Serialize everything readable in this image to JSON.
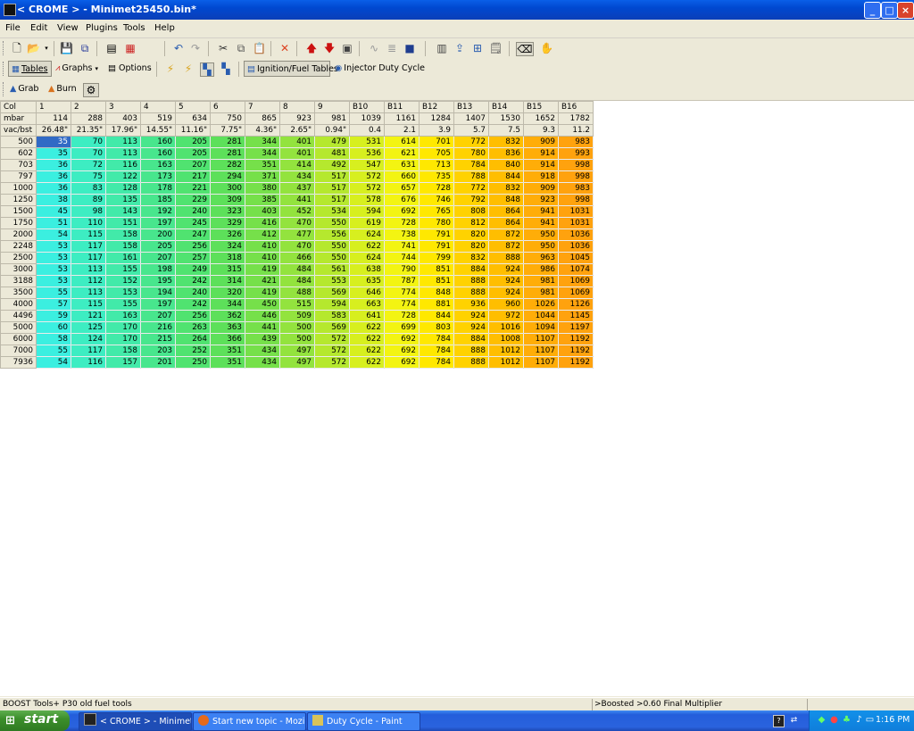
{
  "window": {
    "title": "< CROME > - Minimet25450.bin*",
    "controls": [
      "minimize",
      "maximize",
      "close"
    ]
  },
  "menu": [
    "File",
    "Edit",
    "View",
    "Plugins",
    "Tools",
    "Help"
  ],
  "toolbar3": {
    "grab_label": "Grab",
    "burn_label": "Burn"
  },
  "toolbar2": {
    "tables_label": "Tables",
    "graphs_label": "Graphs",
    "options_label": "Options",
    "ignition_label": "Ignition/Fuel Tables",
    "injector_label": "Injector Duty Cycle"
  },
  "table": {
    "col_header_label": "Col",
    "mbar_label": "mbar",
    "vacbst_label": "vac/bst",
    "columns": [
      "1",
      "2",
      "3",
      "4",
      "5",
      "6",
      "7",
      "8",
      "9",
      "B10",
      "B11",
      "B12",
      "B13",
      "B14",
      "B15",
      "B16"
    ],
    "mbar": [
      "114",
      "288",
      "403",
      "519",
      "634",
      "750",
      "865",
      "923",
      "981",
      "1039",
      "1161",
      "1284",
      "1407",
      "1530",
      "1652",
      "1782"
    ],
    "vacbst": [
      "26.48\"",
      "21.35\"",
      "17.96\"",
      "14.55\"",
      "11.16\"",
      "7.75\"",
      "4.36\"",
      "2.65\"",
      "0.94\"",
      "0.4",
      "2.1",
      "3.9",
      "5.7",
      "7.5",
      "9.3",
      "11.2"
    ],
    "col_colors": [
      "#3BEFE0",
      "#3DEDC2",
      "#42EAA9",
      "#48E68D",
      "#50E370",
      "#5DE05A",
      "#76E04A",
      "#93E33E",
      "#B5E82E",
      "#D7EF1F",
      "#F3F412",
      "#FFE800",
      "#FFD200",
      "#FFBE00",
      "#FFAD08",
      "#FFA20E"
    ],
    "selected_cell": {
      "row": 0,
      "col": 0
    },
    "rows": [
      {
        "rpm": "500",
        "v": [
          "35",
          "70",
          "113",
          "160",
          "205",
          "281",
          "344",
          "401",
          "479",
          "531",
          "614",
          "701",
          "772",
          "832",
          "909",
          "983"
        ]
      },
      {
        "rpm": "602",
        "v": [
          "35",
          "70",
          "113",
          "160",
          "205",
          "281",
          "344",
          "401",
          "481",
          "536",
          "621",
          "705",
          "780",
          "836",
          "914",
          "993"
        ]
      },
      {
        "rpm": "703",
        "v": [
          "36",
          "72",
          "116",
          "163",
          "207",
          "282",
          "351",
          "414",
          "492",
          "547",
          "631",
          "713",
          "784",
          "840",
          "914",
          "998"
        ]
      },
      {
        "rpm": "797",
        "v": [
          "36",
          "75",
          "122",
          "173",
          "217",
          "294",
          "371",
          "434",
          "517",
          "572",
          "660",
          "735",
          "788",
          "844",
          "918",
          "998"
        ]
      },
      {
        "rpm": "1000",
        "v": [
          "36",
          "83",
          "128",
          "178",
          "221",
          "300",
          "380",
          "437",
          "517",
          "572",
          "657",
          "728",
          "772",
          "832",
          "909",
          "983"
        ]
      },
      {
        "rpm": "1250",
        "v": [
          "38",
          "89",
          "135",
          "185",
          "229",
          "309",
          "385",
          "441",
          "517",
          "578",
          "676",
          "746",
          "792",
          "848",
          "923",
          "998"
        ]
      },
      {
        "rpm": "1500",
        "v": [
          "45",
          "98",
          "143",
          "192",
          "240",
          "323",
          "403",
          "452",
          "534",
          "594",
          "692",
          "765",
          "808",
          "864",
          "941",
          "1031"
        ]
      },
      {
        "rpm": "1750",
        "v": [
          "51",
          "110",
          "151",
          "197",
          "245",
          "329",
          "416",
          "470",
          "550",
          "619",
          "728",
          "780",
          "812",
          "864",
          "941",
          "1031"
        ]
      },
      {
        "rpm": "2000",
        "v": [
          "54",
          "115",
          "158",
          "200",
          "247",
          "326",
          "412",
          "477",
          "556",
          "624",
          "738",
          "791",
          "820",
          "872",
          "950",
          "1036"
        ]
      },
      {
        "rpm": "2248",
        "v": [
          "53",
          "117",
          "158",
          "205",
          "256",
          "324",
          "410",
          "470",
          "550",
          "622",
          "741",
          "791",
          "820",
          "872",
          "950",
          "1036"
        ]
      },
      {
        "rpm": "2500",
        "v": [
          "53",
          "117",
          "161",
          "207",
          "257",
          "318",
          "410",
          "466",
          "550",
          "624",
          "744",
          "799",
          "832",
          "888",
          "963",
          "1045"
        ]
      },
      {
        "rpm": "3000",
        "v": [
          "53",
          "113",
          "155",
          "198",
          "249",
          "315",
          "419",
          "484",
          "561",
          "638",
          "790",
          "851",
          "884",
          "924",
          "986",
          "1074"
        ]
      },
      {
        "rpm": "3188",
        "v": [
          "53",
          "112",
          "152",
          "195",
          "242",
          "314",
          "421",
          "484",
          "553",
          "635",
          "787",
          "851",
          "888",
          "924",
          "981",
          "1069"
        ]
      },
      {
        "rpm": "3500",
        "v": [
          "55",
          "113",
          "153",
          "194",
          "240",
          "320",
          "419",
          "488",
          "569",
          "646",
          "774",
          "848",
          "888",
          "924",
          "981",
          "1069"
        ]
      },
      {
        "rpm": "4000",
        "v": [
          "57",
          "115",
          "155",
          "197",
          "242",
          "344",
          "450",
          "515",
          "594",
          "663",
          "774",
          "881",
          "936",
          "960",
          "1026",
          "1126"
        ]
      },
      {
        "rpm": "4496",
        "v": [
          "59",
          "121",
          "163",
          "207",
          "256",
          "362",
          "446",
          "509",
          "583",
          "641",
          "728",
          "844",
          "924",
          "972",
          "1044",
          "1145"
        ]
      },
      {
        "rpm": "5000",
        "v": [
          "60",
          "125",
          "170",
          "216",
          "263",
          "363",
          "441",
          "500",
          "569",
          "622",
          "699",
          "803",
          "924",
          "1016",
          "1094",
          "1197"
        ]
      },
      {
        "rpm": "6000",
        "v": [
          "58",
          "124",
          "170",
          "215",
          "264",
          "366",
          "439",
          "500",
          "572",
          "622",
          "692",
          "784",
          "884",
          "1008",
          "1107",
          "1192"
        ]
      },
      {
        "rpm": "7000",
        "v": [
          "55",
          "117",
          "158",
          "203",
          "252",
          "351",
          "434",
          "497",
          "572",
          "622",
          "692",
          "784",
          "888",
          "1012",
          "1107",
          "1192"
        ]
      },
      {
        "rpm": "7936",
        "v": [
          "54",
          "116",
          "157",
          "201",
          "250",
          "351",
          "434",
          "497",
          "572",
          "622",
          "692",
          "784",
          "888",
          "1012",
          "1107",
          "1192"
        ]
      }
    ]
  },
  "statusbar": {
    "left": "BOOST Tools+ P30 old fuel tools",
    "right": ">Boosted >0.60 Final Multiplier"
  },
  "taskbar": {
    "start_label": "start",
    "tasks": [
      "< CROME > - Minimet...",
      "Start new topic - Mozi...",
      "Duty Cycle - Paint"
    ],
    "clock": "1:16 PM"
  }
}
